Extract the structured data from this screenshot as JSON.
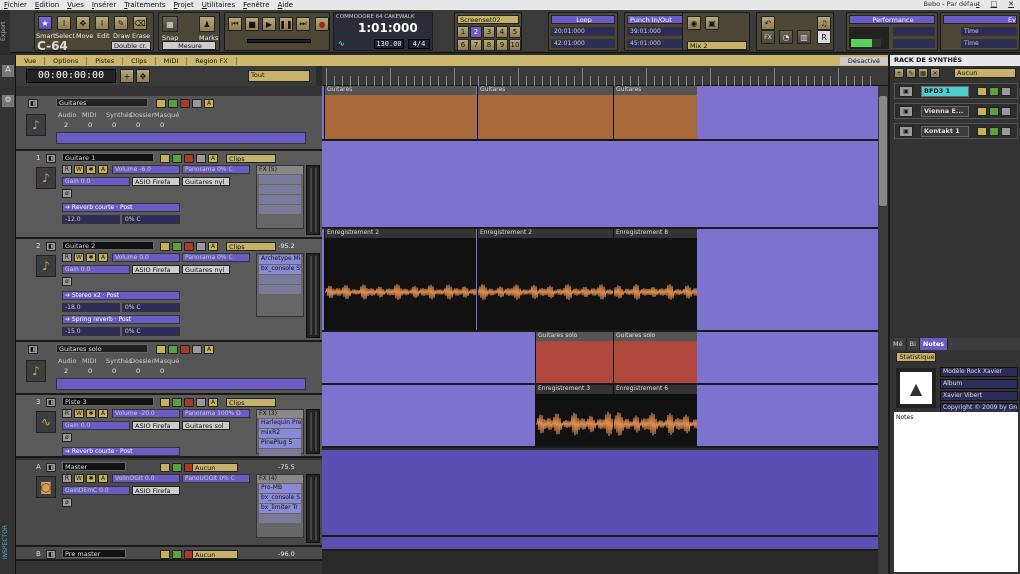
{
  "menu": [
    "Fichier",
    "Edition",
    "Vues",
    "Insérer",
    "Traitements",
    "Projet",
    "Utilitaires",
    "Fenêtre",
    "Aide"
  ],
  "window_title": "Bebo - Par défaut",
  "control_bar": {
    "export_label": "Export",
    "tools": [
      "Smart",
      "Select",
      "Move",
      "Edit",
      "Draw",
      "Erase"
    ],
    "logo": "C-64",
    "double_label": "Double cr.",
    "snap_label": "Snap",
    "marks_label": "Marks",
    "measure_label": "Mesure",
    "project_name": "COMMODORE 64 CAKEWALK",
    "time_display": "1:01:000",
    "tempo": "130.00",
    "meter": "4/4",
    "screenset_label": "Screenset02",
    "screensets": [
      "1",
      "2",
      "3",
      "4",
      "5",
      "6",
      "7",
      "8",
      "9",
      "10"
    ],
    "loop_title": "Loop",
    "loop_start": "20:01:000",
    "loop_end": "42:01:000",
    "punch_title": "Punch In/Out",
    "punch_start": "39:01:000",
    "punch_end": "45:01:000",
    "mix_label": "Mix 2",
    "performance_title": "Performance",
    "ev_title": "Ev",
    "ev_rows": [
      "Time",
      "Time"
    ]
  },
  "view_menu": [
    "Vue",
    "Options",
    "Pistes",
    "Clips",
    "MIDI",
    "Region FX"
  ],
  "timecode": "00:00:00:00",
  "filter": "Tout",
  "fx_disabled": "Désactivé",
  "tracks": [
    {
      "number": "",
      "name": "Guitares",
      "type": "folder",
      "stats": {
        "labels": [
          "Audio",
          "MIDI",
          "Synthés",
          "Dossier",
          "Masqué"
        ],
        "values": [
          "2",
          "0",
          "0",
          "0",
          "0"
        ]
      }
    },
    {
      "number": "1",
      "name": "Guitare 1",
      "clips_label": "Clips",
      "volume": "Volume",
      "vol_val": "-6.0",
      "pan": "Panorama",
      "pan_val": "0% C",
      "gain": "Gain",
      "gain_val": "0.0",
      "input": "ASIO Firefa",
      "output": "Guitares nyl",
      "fx_header": "FX (5)",
      "fx": [],
      "send1": "Reverb courte",
      "send_post": "Post",
      "send_val": "-12.0",
      "send_pan": "0% C"
    },
    {
      "number": "2",
      "name": "Guitare 2",
      "clips_label": "Clips",
      "level": "-95.2",
      "volume": "Volume",
      "vol_val": "0.0",
      "pan": "Panorama",
      "pan_val": "0% C",
      "gain": "Gain",
      "gain_val": "0.0",
      "input": "ASIO Firefa",
      "output": "Guitares nyl",
      "fx": [
        "Archetype Mini",
        "bx_console SS"
      ],
      "send1": "Stereo x2",
      "send_post": "Post",
      "send_val": "-18.0",
      "send_pan": "0% C",
      "send2": "Spring reverb",
      "send2_val": "-15.0",
      "send2_pan": "0% C"
    },
    {
      "number": "",
      "name": "Guitares solo",
      "type": "folder",
      "stats": {
        "labels": [
          "Audio",
          "MIDI",
          "Synthés",
          "Dossier",
          "Masqué"
        ],
        "values": [
          "2",
          "0",
          "0",
          "0",
          "0"
        ]
      }
    },
    {
      "number": "3",
      "name": "Piste 3",
      "clips_label": "Clips",
      "volume": "Volume",
      "vol_val": "-20.0",
      "pan": "Panorama",
      "pan_val": "100% D",
      "gain": "Gain",
      "gain_val": "0.0",
      "input": "ASIO Firefa",
      "output": "Guitares sol",
      "fx_header": "FX (3)",
      "fx": [
        "Harlequin Pres",
        "mixR2",
        "PinePlug 5"
      ],
      "send1": "Reverb courte",
      "send_post": "Post"
    },
    {
      "number": "A",
      "name": "Master",
      "route": "Aucun",
      "level": "-75.5",
      "volume": "VolInOGlt",
      "vol_val": "0.0",
      "pan": "PanoUOGlt",
      "pan_val": "0% C",
      "gain": "GainDEmC",
      "gain_val": "0.0",
      "input": "ASIO Firefa",
      "fx_header": "FX (4)",
      "fx": [
        "Pro-MB",
        "bx_console S",
        "bx_limiter Tr"
      ]
    },
    {
      "number": "B",
      "name": "Pre master",
      "route": "Aucun",
      "level": "-96.0"
    }
  ],
  "lanes": [
    {
      "clips": [
        {
          "name": "Guitares"
        },
        {
          "name": "Guitares"
        },
        {
          "name": "Guitares"
        }
      ]
    },
    {
      "clips": []
    },
    {
      "clips": [
        {
          "name": "Enregistrement 2"
        },
        {
          "name": "Enregistrement 2"
        },
        {
          "name": "Enregistrement 8"
        }
      ]
    },
    {
      "clips": [
        {
          "name": "Guitares solo"
        },
        {
          "name": "Guitares solo"
        }
      ]
    },
    {
      "clips": [
        {
          "name": "Enregistrement 3"
        },
        {
          "name": "Enregistrement 6"
        }
      ]
    }
  ],
  "rack": {
    "title": "RACK DE SYNTHÉS",
    "filter": "Aucun",
    "synths": [
      "BFD3 1",
      "Vienna E...",
      "Kontakt 1"
    ]
  },
  "notes": {
    "tabs": [
      "Mé",
      "Bi",
      "Notes"
    ],
    "subtab": "Statistique",
    "fields": [
      "Modèle Rock Xavier",
      "Album",
      "Xavier Vibert",
      "Copyright © 2009 by Greta"
    ],
    "notes_label": "Notes"
  },
  "inspector_label": "INSPECTOR"
}
